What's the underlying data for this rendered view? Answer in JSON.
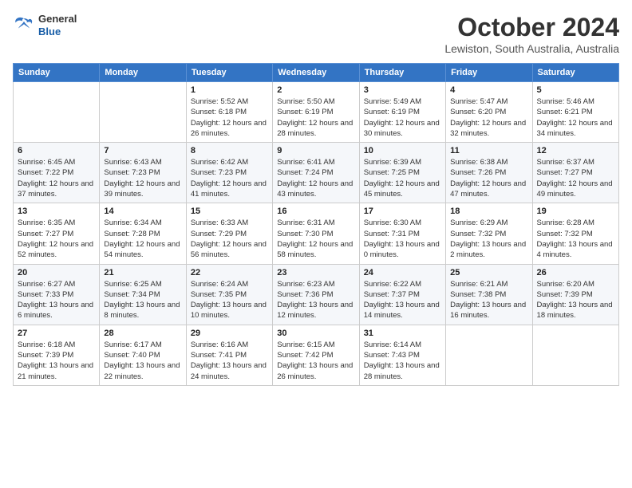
{
  "header": {
    "logo_line1": "General",
    "logo_line2": "Blue",
    "month": "October 2024",
    "location": "Lewiston, South Australia, Australia"
  },
  "days_of_week": [
    "Sunday",
    "Monday",
    "Tuesday",
    "Wednesday",
    "Thursday",
    "Friday",
    "Saturday"
  ],
  "weeks": [
    [
      {
        "day": "",
        "content": ""
      },
      {
        "day": "",
        "content": ""
      },
      {
        "day": "1",
        "content": "Sunrise: 5:52 AM\nSunset: 6:18 PM\nDaylight: 12 hours and 26 minutes."
      },
      {
        "day": "2",
        "content": "Sunrise: 5:50 AM\nSunset: 6:19 PM\nDaylight: 12 hours and 28 minutes."
      },
      {
        "day": "3",
        "content": "Sunrise: 5:49 AM\nSunset: 6:19 PM\nDaylight: 12 hours and 30 minutes."
      },
      {
        "day": "4",
        "content": "Sunrise: 5:47 AM\nSunset: 6:20 PM\nDaylight: 12 hours and 32 minutes."
      },
      {
        "day": "5",
        "content": "Sunrise: 5:46 AM\nSunset: 6:21 PM\nDaylight: 12 hours and 34 minutes."
      }
    ],
    [
      {
        "day": "6",
        "content": "Sunrise: 6:45 AM\nSunset: 7:22 PM\nDaylight: 12 hours and 37 minutes."
      },
      {
        "day": "7",
        "content": "Sunrise: 6:43 AM\nSunset: 7:23 PM\nDaylight: 12 hours and 39 minutes."
      },
      {
        "day": "8",
        "content": "Sunrise: 6:42 AM\nSunset: 7:23 PM\nDaylight: 12 hours and 41 minutes."
      },
      {
        "day": "9",
        "content": "Sunrise: 6:41 AM\nSunset: 7:24 PM\nDaylight: 12 hours and 43 minutes."
      },
      {
        "day": "10",
        "content": "Sunrise: 6:39 AM\nSunset: 7:25 PM\nDaylight: 12 hours and 45 minutes."
      },
      {
        "day": "11",
        "content": "Sunrise: 6:38 AM\nSunset: 7:26 PM\nDaylight: 12 hours and 47 minutes."
      },
      {
        "day": "12",
        "content": "Sunrise: 6:37 AM\nSunset: 7:27 PM\nDaylight: 12 hours and 49 minutes."
      }
    ],
    [
      {
        "day": "13",
        "content": "Sunrise: 6:35 AM\nSunset: 7:27 PM\nDaylight: 12 hours and 52 minutes."
      },
      {
        "day": "14",
        "content": "Sunrise: 6:34 AM\nSunset: 7:28 PM\nDaylight: 12 hours and 54 minutes."
      },
      {
        "day": "15",
        "content": "Sunrise: 6:33 AM\nSunset: 7:29 PM\nDaylight: 12 hours and 56 minutes."
      },
      {
        "day": "16",
        "content": "Sunrise: 6:31 AM\nSunset: 7:30 PM\nDaylight: 12 hours and 58 minutes."
      },
      {
        "day": "17",
        "content": "Sunrise: 6:30 AM\nSunset: 7:31 PM\nDaylight: 13 hours and 0 minutes."
      },
      {
        "day": "18",
        "content": "Sunrise: 6:29 AM\nSunset: 7:32 PM\nDaylight: 13 hours and 2 minutes."
      },
      {
        "day": "19",
        "content": "Sunrise: 6:28 AM\nSunset: 7:32 PM\nDaylight: 13 hours and 4 minutes."
      }
    ],
    [
      {
        "day": "20",
        "content": "Sunrise: 6:27 AM\nSunset: 7:33 PM\nDaylight: 13 hours and 6 minutes."
      },
      {
        "day": "21",
        "content": "Sunrise: 6:25 AM\nSunset: 7:34 PM\nDaylight: 13 hours and 8 minutes."
      },
      {
        "day": "22",
        "content": "Sunrise: 6:24 AM\nSunset: 7:35 PM\nDaylight: 13 hours and 10 minutes."
      },
      {
        "day": "23",
        "content": "Sunrise: 6:23 AM\nSunset: 7:36 PM\nDaylight: 13 hours and 12 minutes."
      },
      {
        "day": "24",
        "content": "Sunrise: 6:22 AM\nSunset: 7:37 PM\nDaylight: 13 hours and 14 minutes."
      },
      {
        "day": "25",
        "content": "Sunrise: 6:21 AM\nSunset: 7:38 PM\nDaylight: 13 hours and 16 minutes."
      },
      {
        "day": "26",
        "content": "Sunrise: 6:20 AM\nSunset: 7:39 PM\nDaylight: 13 hours and 18 minutes."
      }
    ],
    [
      {
        "day": "27",
        "content": "Sunrise: 6:18 AM\nSunset: 7:39 PM\nDaylight: 13 hours and 21 minutes."
      },
      {
        "day": "28",
        "content": "Sunrise: 6:17 AM\nSunset: 7:40 PM\nDaylight: 13 hours and 22 minutes."
      },
      {
        "day": "29",
        "content": "Sunrise: 6:16 AM\nSunset: 7:41 PM\nDaylight: 13 hours and 24 minutes."
      },
      {
        "day": "30",
        "content": "Sunrise: 6:15 AM\nSunset: 7:42 PM\nDaylight: 13 hours and 26 minutes."
      },
      {
        "day": "31",
        "content": "Sunrise: 6:14 AM\nSunset: 7:43 PM\nDaylight: 13 hours and 28 minutes."
      },
      {
        "day": "",
        "content": ""
      },
      {
        "day": "",
        "content": ""
      }
    ]
  ]
}
